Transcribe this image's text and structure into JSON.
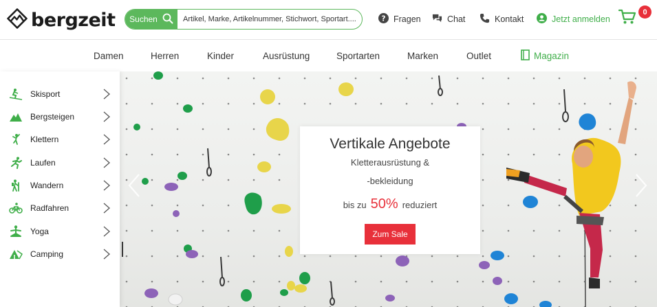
{
  "header": {
    "logo_text": "bergzeit",
    "search": {
      "button_label": "Suchen",
      "placeholder": "Artikel, Marke, Artikelnummer, Stichwort, Sportart...."
    },
    "links": {
      "faq": "Fragen",
      "chat": "Chat",
      "contact": "Kontakt",
      "login": "Jetzt anmelden"
    },
    "cart_count": "0"
  },
  "nav": {
    "items": [
      "Damen",
      "Herren",
      "Kinder",
      "Ausrüstung",
      "Sportarten",
      "Marken",
      "Outlet"
    ],
    "magazine": "Magazin"
  },
  "sidebar": {
    "items": [
      {
        "label": "Skisport",
        "icon": "skiing-icon"
      },
      {
        "label": "Bergsteigen",
        "icon": "mountain-icon"
      },
      {
        "label": "Klettern",
        "icon": "climbing-icon"
      },
      {
        "label": "Laufen",
        "icon": "running-icon"
      },
      {
        "label": "Wandern",
        "icon": "hiking-icon"
      },
      {
        "label": "Radfahren",
        "icon": "cycling-icon"
      },
      {
        "label": "Yoga",
        "icon": "yoga-icon"
      },
      {
        "label": "Camping",
        "icon": "tent-icon"
      }
    ]
  },
  "hero": {
    "title": "Vertikale Angebote",
    "subtitle_line1": "Kletterausrüstung &",
    "subtitle_line2": "-bekleidung",
    "sale_prefix": "bis zu",
    "sale_percent": "50%",
    "sale_suffix": "reduziert",
    "cta": "Zum Sale"
  },
  "colors": {
    "brand_green": "#5cb85c",
    "accent_red": "#e8303a",
    "text": "#333333"
  }
}
